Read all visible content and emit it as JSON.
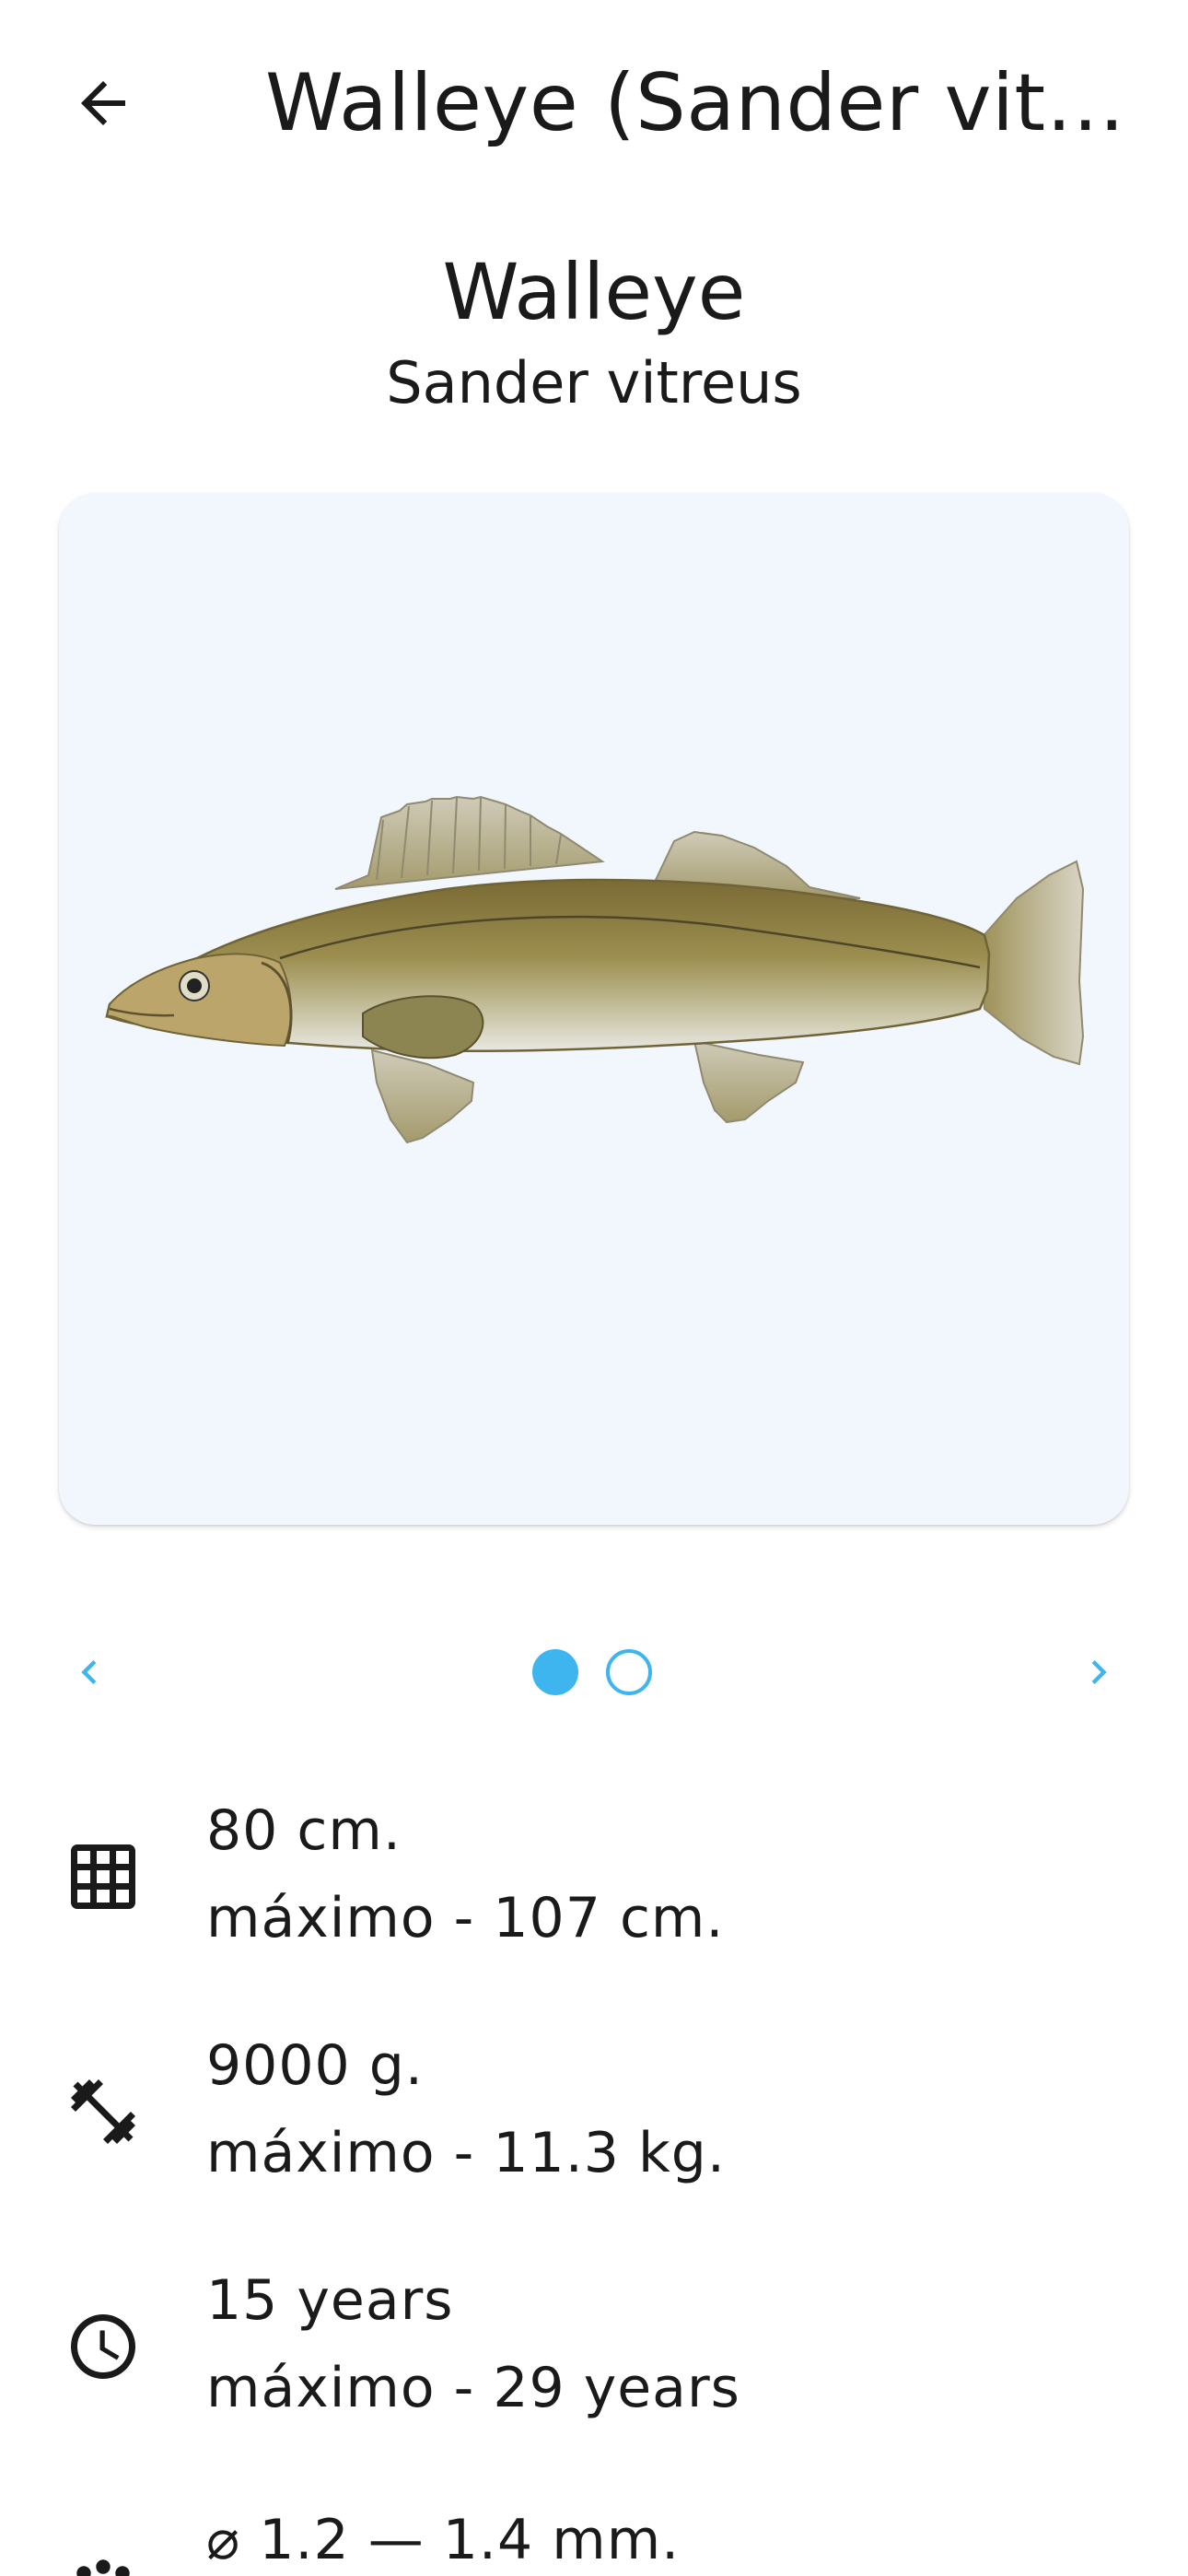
{
  "appbar": {
    "title": "Walleye (Sander vitre…",
    "back_icon": "arrow-left-icon"
  },
  "fish": {
    "common_name": "Walleye",
    "scientific_name": "Sander vitreus"
  },
  "carousel": {
    "background": "#f1f7fd",
    "accent_color": "#3fb5f0",
    "page_count": 2,
    "active_page": 1,
    "prev_icon": "chevron-left-icon",
    "next_icon": "chevron-right-icon"
  },
  "stats": {
    "length": {
      "icon": "grid-icon",
      "value": "80 cm.",
      "max": "máximo - 107 cm."
    },
    "weight": {
      "icon": "dumbbell-icon",
      "value": "9000 g.",
      "max": "máximo - 11.3 kg."
    },
    "age": {
      "icon": "clock-icon",
      "value": "15 years",
      "max": "máximo - 29 years"
    },
    "eggs": {
      "icon": "eggs-icon",
      "value": "⌀ 1.2 — 1.4 mm."
    }
  }
}
